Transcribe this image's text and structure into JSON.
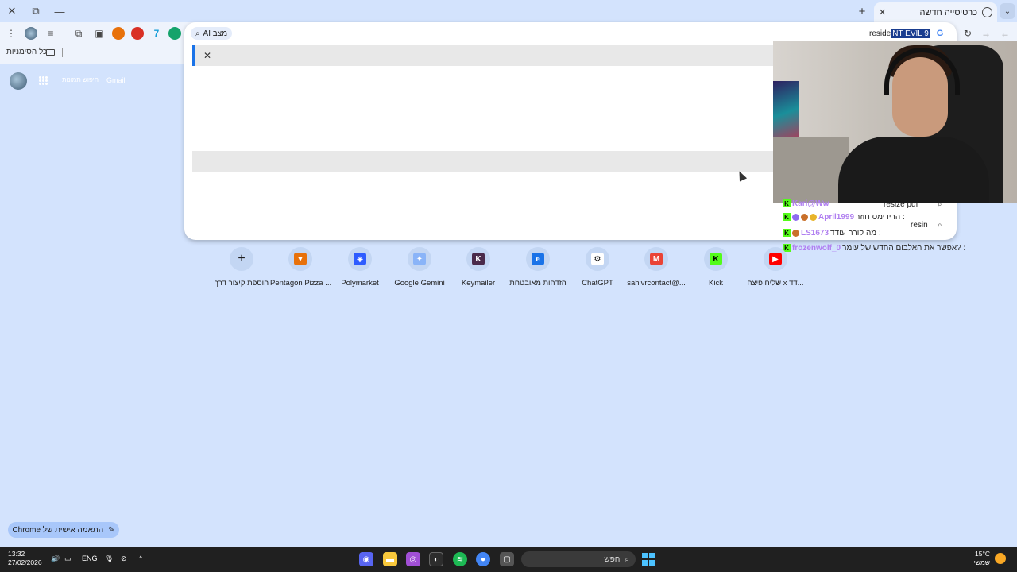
{
  "window": {
    "tab_title": "כרטיסייה חדשה",
    "close_symbol": "✕",
    "restore_symbol": "⧉",
    "minimize_symbol": "—",
    "new_tab_symbol": "+",
    "tab_close_symbol": "✕",
    "tab_search_symbol": "⌄"
  },
  "toolbar": {
    "back_symbol": "←",
    "forward_symbol": "→",
    "reload_symbol": "↻",
    "menu_symbol": "⋮"
  },
  "omnibox": {
    "typed_text": "reside",
    "selected_completion": "NT EVIL 9",
    "ai_mode_label": "מצב AI",
    "google_letter": "G",
    "clear_symbol": "✕",
    "suggestions": [
      {
        "text": "resize pdf"
      },
      {
        "text": "resin"
      }
    ]
  },
  "bookmarks_bar": {
    "all_bookmarks": "כל הסימניות"
  },
  "ntp_header": {
    "gmail": "Gmail",
    "search_images": "חיפוש תמונות"
  },
  "shortcuts": [
    {
      "label": "הוספת קיצור דרך",
      "icon": "+",
      "color": "#c3d6f3"
    },
    {
      "label": "Pentagon Pizza ...",
      "icon": "▼",
      "color": "#e8710a"
    },
    {
      "label": "Polymarket",
      "icon": "◈",
      "color": "#2e5cff"
    },
    {
      "label": "Google Gemini",
      "icon": "✦",
      "color": "#8ab4f8"
    },
    {
      "label": "Keymailer",
      "icon": "K",
      "color": "#4a2a4a"
    },
    {
      "label": "הזדהות מאובטחת",
      "icon": "e",
      "color": "#1a73e8"
    },
    {
      "label": "ChatGPT",
      "icon": "⚙",
      "color": "#ffffff"
    },
    {
      "label": "sahivrcontact@...",
      "icon": "M",
      "color": "#ea4335"
    },
    {
      "label": "Kick",
      "icon": "K",
      "color": "#53fc18"
    },
    {
      "label": "שליח פיצה x דד...",
      "icon": "▶",
      "color": "#ff0000"
    }
  ],
  "chat": [
    {
      "user": "Kari@Ww",
      "message": "",
      "emotes": []
    },
    {
      "user": "April1999",
      "message": "הרידימס חוזר :",
      "emotes": [
        "#8e6cf0",
        "#c9702a",
        "#e8b42a"
      ]
    },
    {
      "user": "LS1673",
      "message": "מה קורה עודד :",
      "emotes": [
        "#c9702a"
      ]
    },
    {
      "user": "frozenwolf_0",
      "message": "אפשר את האלבום החדש של עומר? :",
      "emotes": []
    }
  ],
  "customize": {
    "label": "התאמה אישית של Chrome",
    "pencil_symbol": "✎"
  },
  "taskbar": {
    "time": "13:32",
    "date": "27/02/2026",
    "language": "ENG",
    "search_placeholder": "חפש",
    "temperature": "15°C",
    "weather_desc": "שמשי",
    "chevron": "^"
  }
}
